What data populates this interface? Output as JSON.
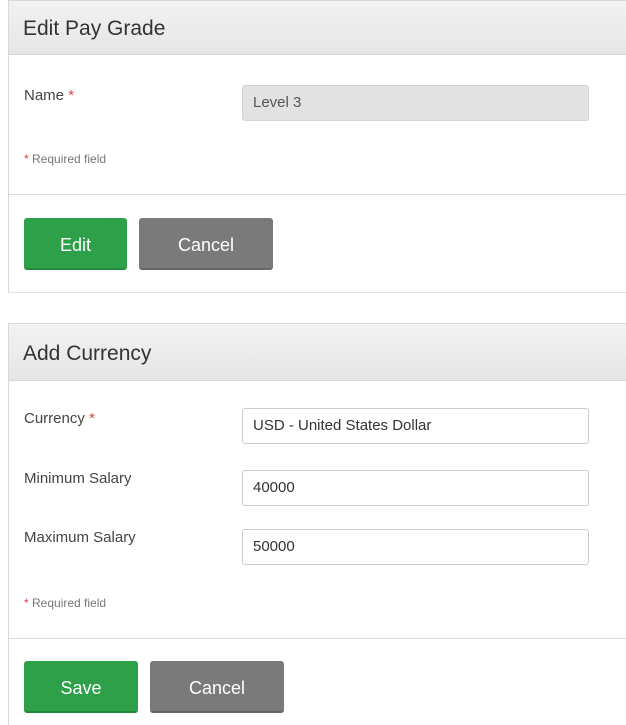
{
  "edit_pay_grade": {
    "title": "Edit Pay Grade",
    "name_label": "Name",
    "required_marker": "*",
    "name_value": "Level 3",
    "required_note_marker": "*",
    "required_note": " Required field",
    "edit_button": "Edit",
    "cancel_button": "Cancel"
  },
  "add_currency": {
    "title": "Add Currency",
    "currency_label": "Currency",
    "required_marker": "*",
    "currency_value": "USD - United States Dollar",
    "min_label": "Minimum Salary",
    "min_value": "40000",
    "max_label": "Maximum Salary",
    "max_value": "50000",
    "required_note_marker": "*",
    "required_note": " Required field",
    "save_button": "Save",
    "cancel_button": "Cancel"
  },
  "colors": {
    "primary_button": "#2ea04a",
    "secondary_button": "#7a7a7a",
    "required_marker": "#e04343"
  }
}
